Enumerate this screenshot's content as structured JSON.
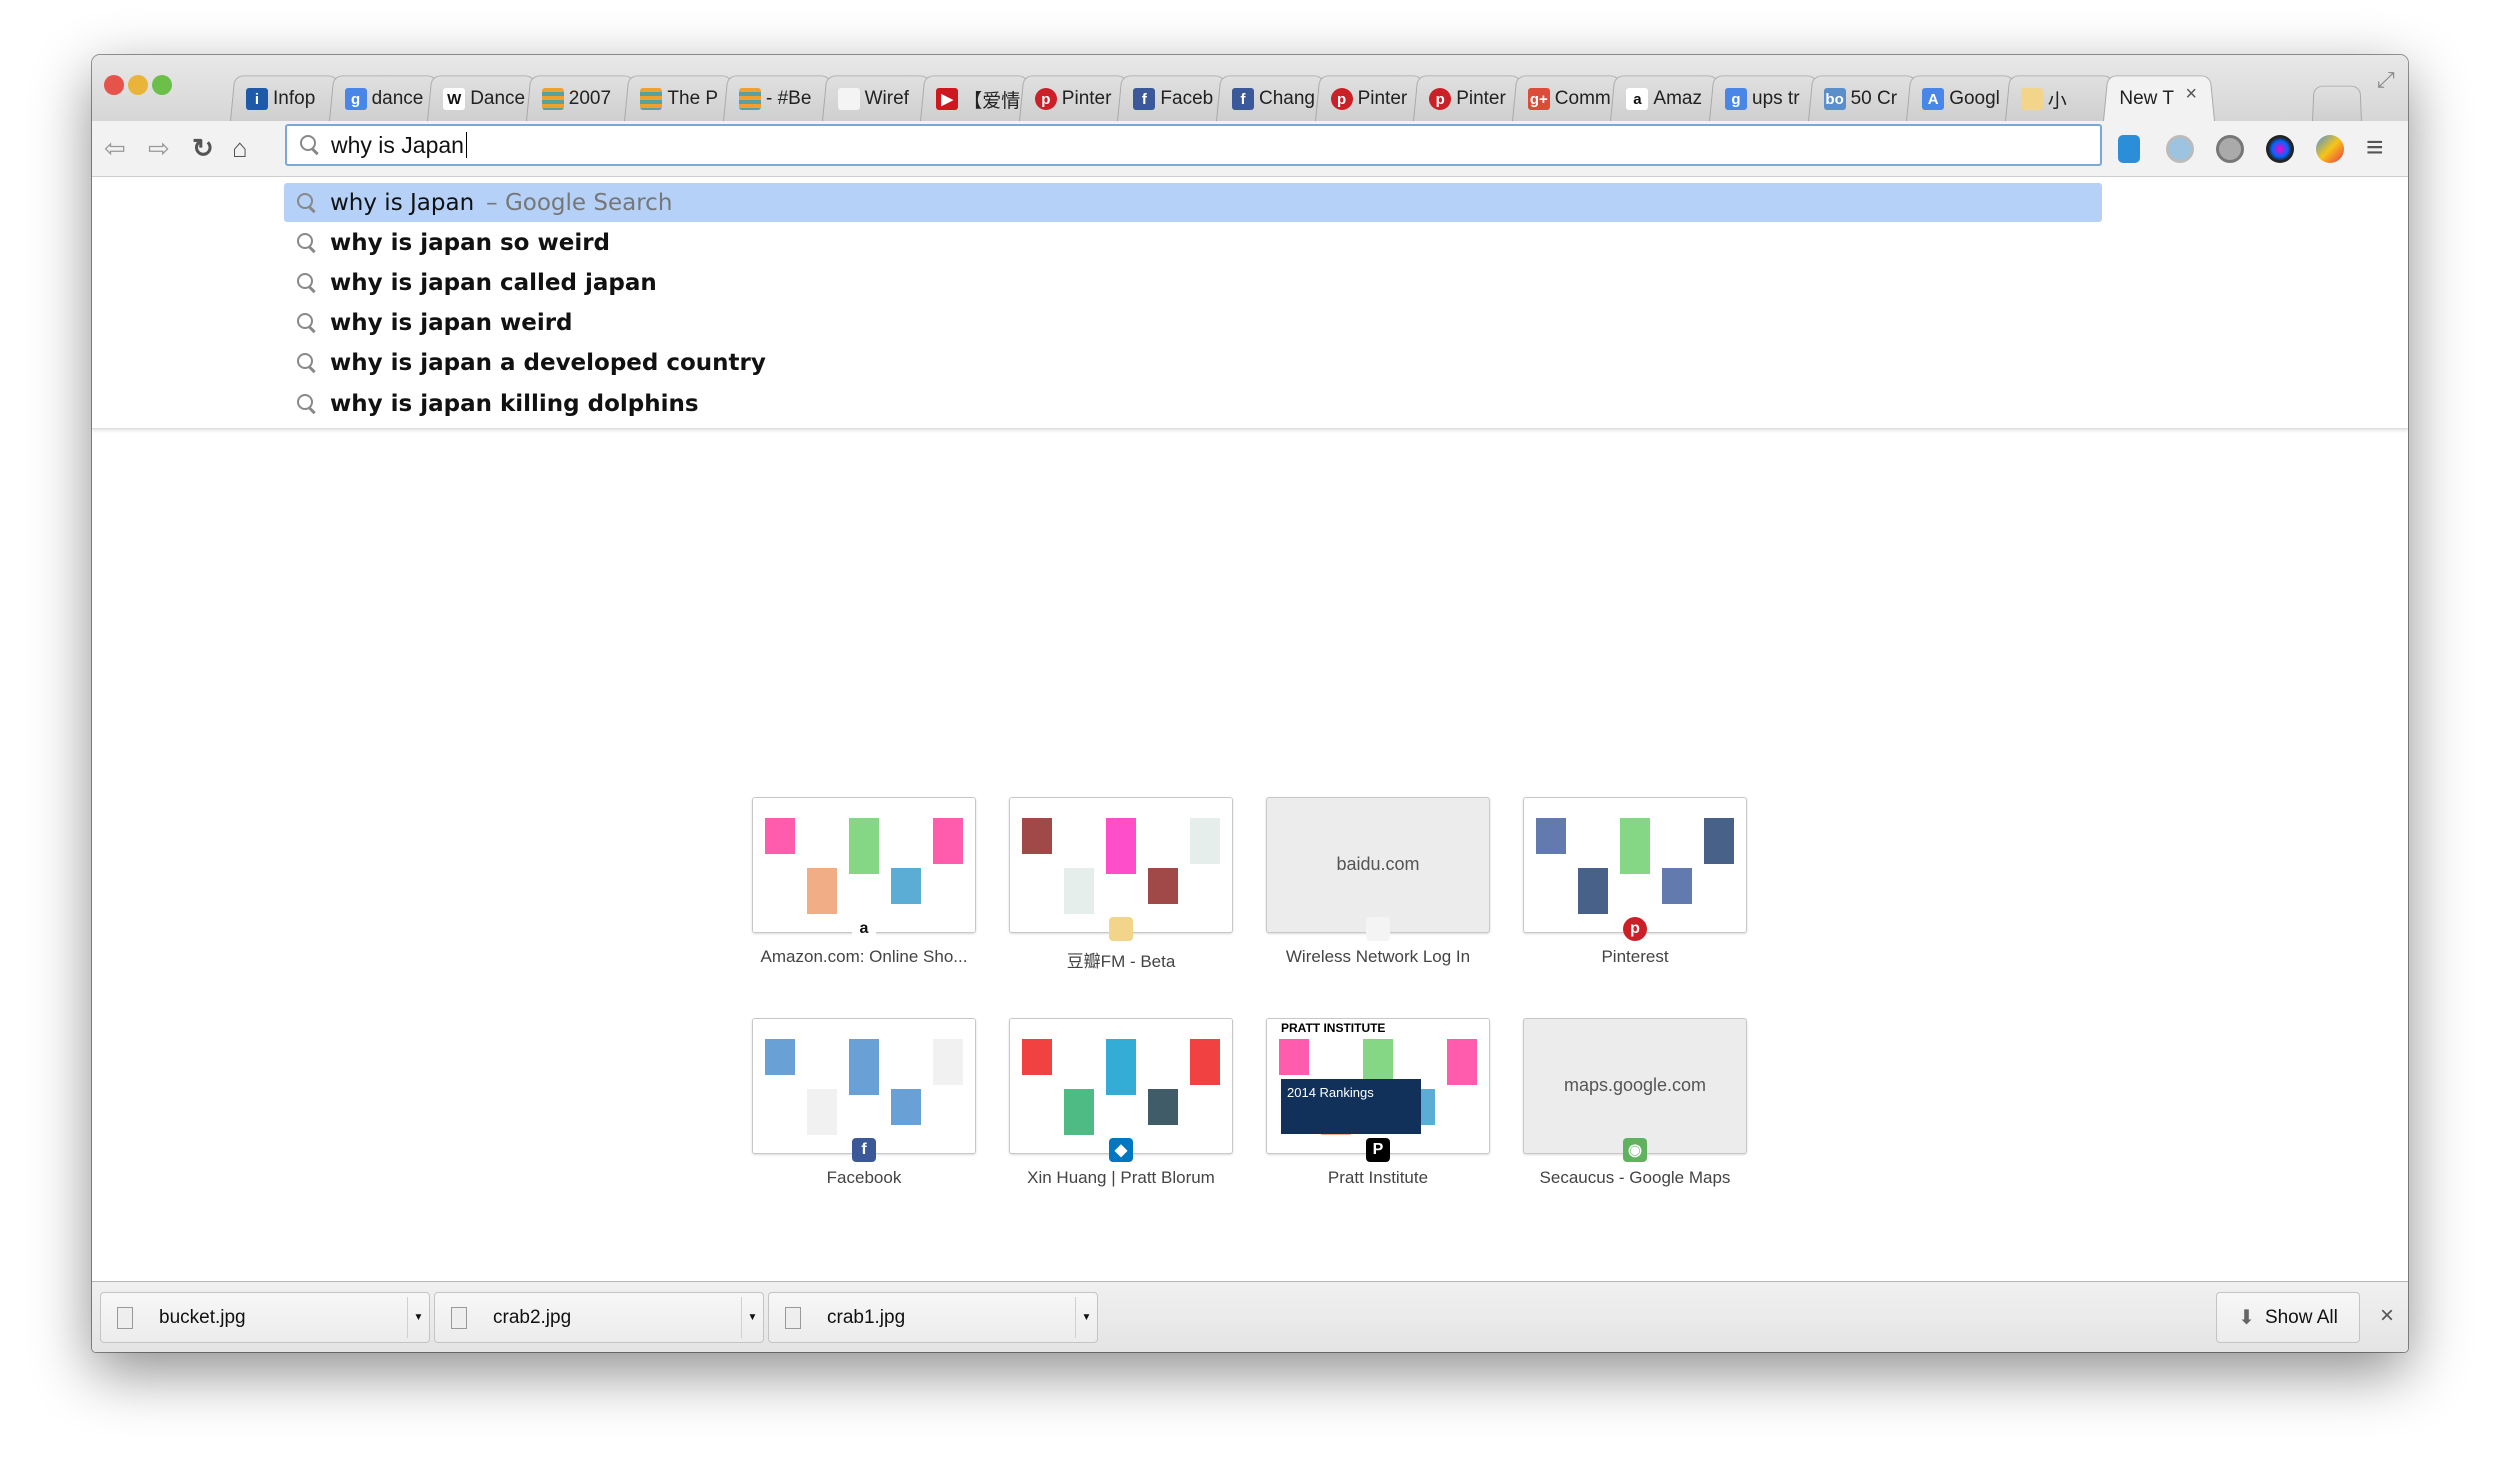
{
  "tabs": [
    {
      "title": "Infop",
      "icon": "info-icon",
      "color": "#1e5aa8",
      "glyph": "i"
    },
    {
      "title": "dance",
      "icon": "google-icon",
      "color": "#4a86e8",
      "glyph": "g"
    },
    {
      "title": "Dance",
      "icon": "wikipedia-icon",
      "color": "#ffffff",
      "glyph": "W"
    },
    {
      "title": "2007",
      "icon": "stripes-icon",
      "color": "#f0a030",
      "glyph": ""
    },
    {
      "title": "The P",
      "icon": "stripes-icon",
      "color": "#f0a030",
      "glyph": ""
    },
    {
      "title": "- #Be",
      "icon": "stripes-icon",
      "color": "#f0a030",
      "glyph": ""
    },
    {
      "title": "Wiref",
      "icon": "document-icon",
      "color": "#f4f4f4",
      "glyph": ""
    },
    {
      "title": "【爱情",
      "icon": "youtube-icon",
      "color": "#cc181e",
      "glyph": "▶"
    },
    {
      "title": "Pinter",
      "icon": "pinterest-icon",
      "color": "#cb2027",
      "glyph": "p"
    },
    {
      "title": "Faceb",
      "icon": "facebook-icon",
      "color": "#3b5998",
      "glyph": "f"
    },
    {
      "title": "Chang",
      "icon": "facebook-icon",
      "color": "#3b5998",
      "glyph": "f"
    },
    {
      "title": "Pinter",
      "icon": "pinterest-icon",
      "color": "#cb2027",
      "glyph": "p"
    },
    {
      "title": "Pinter",
      "icon": "pinterest-icon",
      "color": "#cb2027",
      "glyph": "p"
    },
    {
      "title": "Comm",
      "icon": "google-plus-icon",
      "color": "#dd4b39",
      "glyph": "g+"
    },
    {
      "title": "Amaz",
      "icon": "amazon-icon",
      "color": "#ffffff",
      "glyph": "a"
    },
    {
      "title": "ups tr",
      "icon": "google-icon",
      "color": "#4a86e8",
      "glyph": "g"
    },
    {
      "title": "50 Cr",
      "icon": "bo-icon",
      "color": "#5b8fc9",
      "glyph": "bo"
    },
    {
      "title": "Googl",
      "icon": "translate-icon",
      "color": "#4a86e8",
      "glyph": "A"
    },
    {
      "title": "小",
      "icon": "radio-icon",
      "color": "#f2d48a",
      "glyph": ""
    },
    {
      "title": "New T",
      "icon": "",
      "color": "",
      "glyph": ""
    }
  ],
  "omnibox": {
    "value": "why is Japan"
  },
  "suggestions": [
    {
      "text": "why is Japan",
      "suffix": "– Google Search"
    },
    {
      "text": "why is japan so weird"
    },
    {
      "text": "why is japan called japan"
    },
    {
      "text": "why is japan weird"
    },
    {
      "text": "why is japan a developed country"
    },
    {
      "text": "why is japan killing dolphins"
    }
  ],
  "most_visited": [
    {
      "title": "Amazon.com: Online Sho...",
      "domain": "",
      "icon": "amazon-icon",
      "color": "#ffffff",
      "glyph": "a"
    },
    {
      "title": "豆瓣FM - Beta",
      "domain": "",
      "icon": "radio-icon",
      "color": "#f2d48a",
      "glyph": ""
    },
    {
      "title": "Wireless Network Log In",
      "domain": "baidu.com",
      "icon": "document-icon",
      "color": "#f4f4f4",
      "glyph": ""
    },
    {
      "title": "Pinterest",
      "domain": "",
      "icon": "pinterest-icon",
      "color": "#cb2027",
      "glyph": "p"
    },
    {
      "title": "Facebook",
      "domain": "",
      "icon": "facebook-icon",
      "color": "#3b5998",
      "glyph": "f"
    },
    {
      "title": "Xin Huang | Pratt Blorum",
      "domain": "",
      "icon": "drupal-icon",
      "color": "#0077c0",
      "glyph": "◆"
    },
    {
      "title": "Pratt Institute",
      "domain": "",
      "icon": "pratt-icon",
      "color": "#000000",
      "glyph": "P",
      "header": "PRATT INSTITUTE",
      "banner": "2014 Rankings"
    },
    {
      "title": "Secaucus - Google Maps",
      "domain": "maps.google.com",
      "icon": "google-maps-icon",
      "color": "#5fb35f",
      "glyph": "◉"
    }
  ],
  "downloads": [
    {
      "name": "bucket.jpg"
    },
    {
      "name": "crab2.jpg"
    },
    {
      "name": "crab1.jpg"
    }
  ],
  "download_bar": {
    "show_all": "Show All",
    "close": "×"
  }
}
